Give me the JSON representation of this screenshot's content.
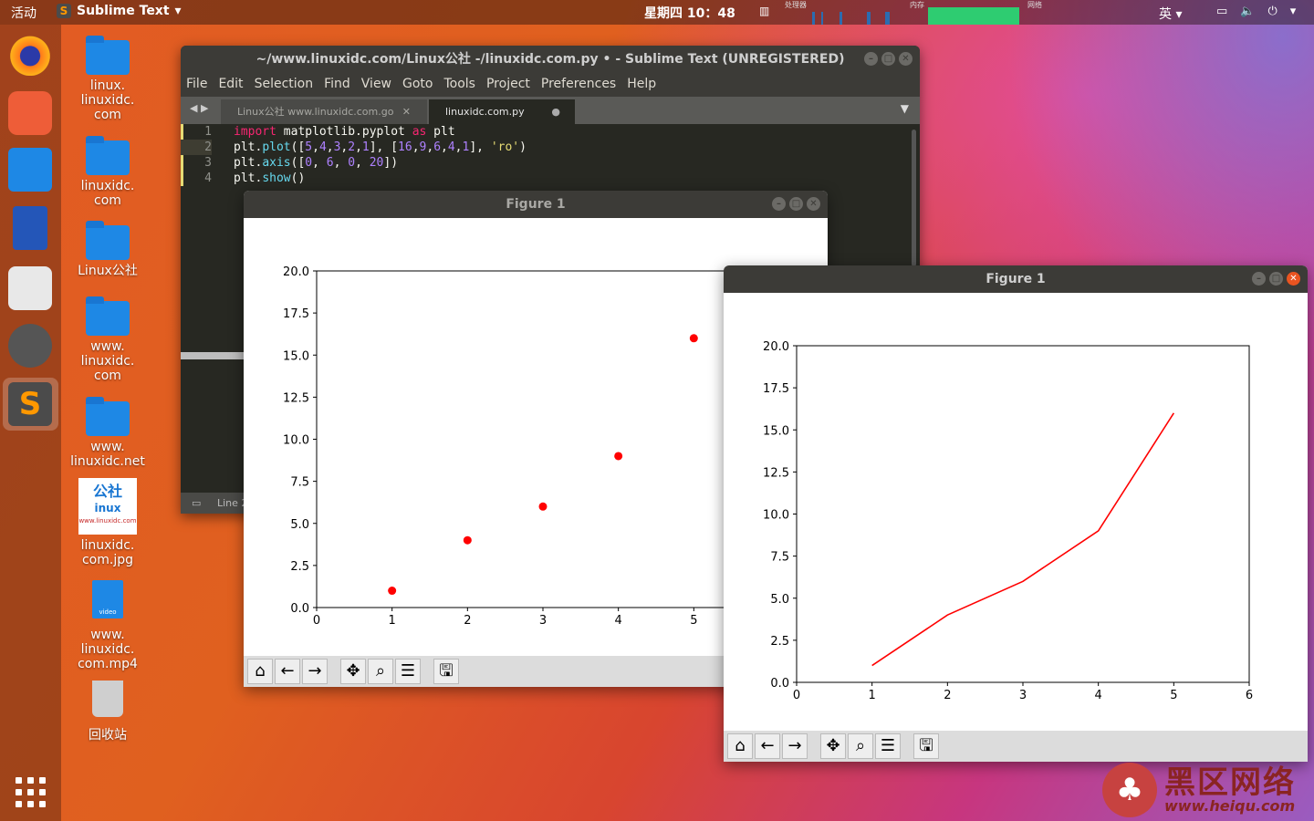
{
  "topbar": {
    "activities": "活动",
    "app_name": "Sublime Text",
    "clock": "星期四 10：48",
    "monitor_cpu": "处理器",
    "monitor_mem": "内存",
    "monitor_net": "网络",
    "lang": "英"
  },
  "desktop": [
    {
      "label": "linux.\nlinuxidc.\ncom"
    },
    {
      "label": "linuxidc.\ncom"
    },
    {
      "label": "Linux公社"
    },
    {
      "label": "www.\nlinuxidc.\ncom"
    },
    {
      "label": "www.\nlinuxidc.net"
    },
    {
      "label": "linuxidc.\ncom.jpg",
      "thumb_lines": [
        "公社",
        "inux",
        "www.linuxidc.com"
      ]
    },
    {
      "label": "www.\nlinuxidc.\ncom.mp4",
      "thumb_text": "video"
    },
    {
      "label": "回收站"
    }
  ],
  "sublime": {
    "title": "~/www.linuxidc.com/Linux公社 -/linuxidc.com.py • - Sublime Text (UNREGISTERED)",
    "menu": [
      "File",
      "Edit",
      "Selection",
      "Find",
      "View",
      "Goto",
      "Tools",
      "Project",
      "Preferences",
      "Help"
    ],
    "tabs": [
      "Linux公社 www.linuxidc.com.go",
      "linuxidc.com.py"
    ],
    "line_numbers": [
      "1",
      "2",
      "3",
      "4"
    ],
    "status": "Line 2"
  },
  "figures": [
    {
      "title": "Figure 1"
    },
    {
      "title": "Figure 1"
    }
  ],
  "chart_data": [
    {
      "type": "scatter",
      "title": "",
      "x": [
        1,
        2,
        3,
        4,
        5
      ],
      "y": [
        1,
        4,
        6,
        9,
        16
      ],
      "xlim": [
        0,
        6
      ],
      "ylim": [
        0,
        20
      ],
      "marker": "ro",
      "color": "#ff0000",
      "xticks": [
        "0",
        "1",
        "2",
        "3",
        "4",
        "5"
      ],
      "yticks": [
        "0.0",
        "2.5",
        "5.0",
        "7.5",
        "10.0",
        "12.5",
        "15.0",
        "17.5",
        "20.0"
      ]
    },
    {
      "type": "line",
      "title": "",
      "x": [
        1,
        2,
        3,
        4,
        5
      ],
      "y": [
        1,
        4,
        6,
        9,
        16
      ],
      "xlim": [
        0,
        6
      ],
      "ylim": [
        0,
        20
      ],
      "color": "#ff0000",
      "xticks": [
        "0",
        "1",
        "2",
        "3",
        "4",
        "5",
        "6"
      ],
      "yticks": [
        "0.0",
        "2.5",
        "5.0",
        "7.5",
        "10.0",
        "12.5",
        "15.0",
        "17.5",
        "20.0"
      ]
    }
  ],
  "watermark": {
    "text1": "黑区网络",
    "text2": "www.heiqu.com"
  }
}
